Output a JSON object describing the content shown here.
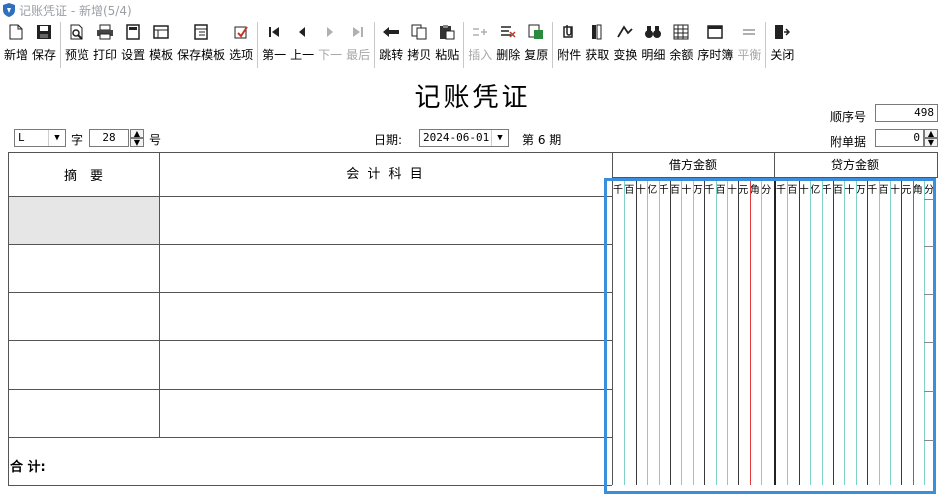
{
  "window": {
    "title": "记账凭证 - 新增(5/4)"
  },
  "toolbar": {
    "groups": [
      [
        {
          "label": "新增",
          "icon": "new-doc-icon"
        },
        {
          "label": "保存",
          "icon": "floppy-save-icon"
        }
      ],
      [
        {
          "label": "预览",
          "icon": "preview-icon"
        },
        {
          "label": "打印",
          "icon": "printer-icon"
        },
        {
          "label": "设置",
          "icon": "page-setup-icon"
        },
        {
          "label": "模板",
          "icon": "template-icon"
        },
        {
          "label": "保存模板",
          "icon": "save-template-icon"
        },
        {
          "label": "选项",
          "icon": "options-icon"
        }
      ],
      [
        {
          "label": "第一",
          "icon": "first-record-icon"
        },
        {
          "label": "上一",
          "icon": "prev-record-icon"
        },
        {
          "label": "下一",
          "icon": "next-record-icon",
          "disabled": true
        },
        {
          "label": "最后",
          "icon": "last-record-icon",
          "disabled": true
        }
      ],
      [
        {
          "label": "跳转",
          "icon": "jump-icon"
        },
        {
          "label": "拷贝",
          "icon": "copy-icon"
        },
        {
          "label": "粘贴",
          "icon": "paste-icon"
        }
      ],
      [
        {
          "label": "插入",
          "icon": "insert-row-icon",
          "disabled": true
        },
        {
          "label": "删除",
          "icon": "delete-row-icon"
        },
        {
          "label": "复原",
          "icon": "restore-icon"
        }
      ],
      [
        {
          "label": "附件",
          "icon": "attachment-icon"
        },
        {
          "label": "获取",
          "icon": "fetch-icon"
        },
        {
          "label": "变换",
          "icon": "transform-icon"
        },
        {
          "label": "明细",
          "icon": "binoculars-icon"
        },
        {
          "label": "余额",
          "icon": "balance-grid-icon"
        },
        {
          "label": "序时簿",
          "icon": "journal-icon"
        },
        {
          "label": "平衡",
          "icon": "balance-equal-icon",
          "disabled": true
        }
      ],
      [
        {
          "label": "关闭",
          "icon": "exit-door-icon"
        }
      ]
    ]
  },
  "voucher": {
    "title": "记账凭证",
    "sequence_label": "顺序号",
    "sequence_value": "498",
    "attachments_label": "附单据",
    "attachments_value": "0",
    "word_type": "L",
    "word_label": "字",
    "number_value": "28",
    "number_label": "号",
    "date_label": "日期:",
    "date_value": "2024-06-01",
    "period_label": "第 6 期"
  },
  "table": {
    "col_summary": "摘　要",
    "col_account": "会 计 科 目",
    "col_debit": "借方金额",
    "col_credit": "贷方金额",
    "digit_units": [
      "千",
      "百",
      "十",
      "亿",
      "千",
      "百",
      "十",
      "万",
      "千",
      "百",
      "十",
      "元",
      "角",
      "分"
    ],
    "total_label": "合 计:"
  }
}
